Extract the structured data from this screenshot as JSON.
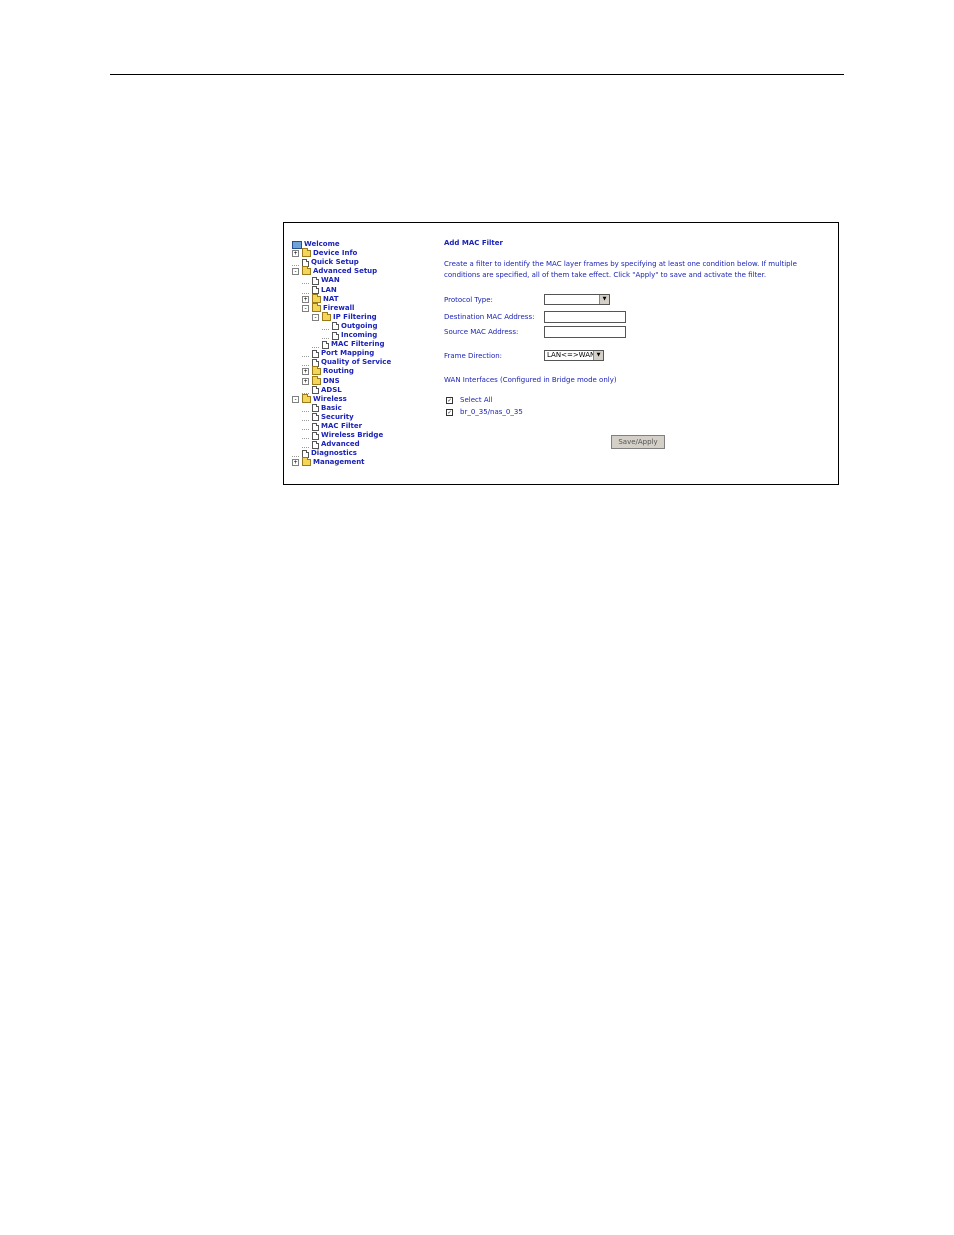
{
  "nav": {
    "items": [
      {
        "label": "Welcome",
        "icon": "monitor-icon",
        "depth": 0,
        "expander": ""
      },
      {
        "label": "Device Info",
        "icon": "folder-icon",
        "depth": 0,
        "expander": "+"
      },
      {
        "label": "Quick Setup",
        "icon": "page-icon",
        "depth": 0,
        "expander": ""
      },
      {
        "label": "Advanced Setup",
        "icon": "folder-open-icon",
        "depth": 0,
        "expander": "-"
      },
      {
        "label": "WAN",
        "icon": "page-icon",
        "depth": 1,
        "expander": ""
      },
      {
        "label": "LAN",
        "icon": "page-icon",
        "depth": 1,
        "expander": ""
      },
      {
        "label": "NAT",
        "icon": "folder-icon",
        "depth": 1,
        "expander": "+"
      },
      {
        "label": "Firewall",
        "icon": "folder-open-icon",
        "depth": 1,
        "expander": "-"
      },
      {
        "label": "IP Filtering",
        "icon": "folder-open-icon",
        "depth": 2,
        "expander": "-"
      },
      {
        "label": "Outgoing",
        "icon": "page-icon",
        "depth": 3,
        "expander": ""
      },
      {
        "label": "Incoming",
        "icon": "page-icon",
        "depth": 3,
        "expander": ""
      },
      {
        "label": "MAC Filtering",
        "icon": "page-icon",
        "depth": 2,
        "expander": ""
      },
      {
        "label": "Port Mapping",
        "icon": "page-icon",
        "depth": 1,
        "expander": ""
      },
      {
        "label": "Quality of Service",
        "icon": "page-icon",
        "depth": 1,
        "expander": ""
      },
      {
        "label": "Routing",
        "icon": "folder-icon",
        "depth": 1,
        "expander": "+"
      },
      {
        "label": "DNS",
        "icon": "folder-icon",
        "depth": 1,
        "expander": "+"
      },
      {
        "label": "ADSL",
        "icon": "page-icon",
        "depth": 1,
        "expander": ""
      },
      {
        "label": "Wireless",
        "icon": "folder-open-icon",
        "depth": 0,
        "expander": "-"
      },
      {
        "label": "Basic",
        "icon": "page-icon",
        "depth": 1,
        "expander": ""
      },
      {
        "label": "Security",
        "icon": "page-icon",
        "depth": 1,
        "expander": ""
      },
      {
        "label": "MAC Filter",
        "icon": "page-icon",
        "depth": 1,
        "expander": ""
      },
      {
        "label": "Wireless Bridge",
        "icon": "page-icon",
        "depth": 1,
        "expander": ""
      },
      {
        "label": "Advanced",
        "icon": "page-icon",
        "depth": 1,
        "expander": ""
      },
      {
        "label": "Diagnostics",
        "icon": "page-icon",
        "depth": 0,
        "expander": ""
      },
      {
        "label": "Management",
        "icon": "folder-icon",
        "depth": 0,
        "expander": "+"
      }
    ]
  },
  "form": {
    "heading": "Add MAC Filter",
    "description": "Create a filter to identify the MAC layer frames by specifying at least one condition below. If multiple conditions are specified, all of them take effect. Click \"Apply\" to save and activate the filter.",
    "protocol_type_label": "Protocol Type:",
    "protocol_type_value": "",
    "dest_mac_label": "Destination MAC Address:",
    "dest_mac_value": "",
    "source_mac_label": "Source MAC Address:",
    "source_mac_value": "",
    "frame_direction_label": "Frame Direction:",
    "frame_direction_value": "LAN<=>WAN",
    "wan_interfaces_label": "WAN Interfaces (Configured in Bridge mode only)",
    "select_all_label": "Select All",
    "select_all_checked": true,
    "interface_label": "br_0_35/nas_0_35",
    "interface_checked": true,
    "apply_button": "Save/Apply"
  },
  "colors": {
    "link_blue": "#1c23b8",
    "button_gray": "#d4d0c8"
  }
}
